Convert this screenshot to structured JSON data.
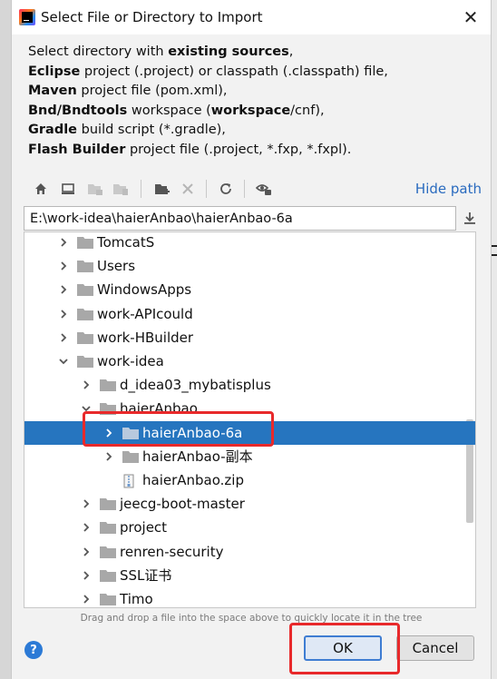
{
  "window": {
    "title": "Select File or Directory to Import",
    "close_symbol": "✕"
  },
  "description": {
    "line1": {
      "pre": "Select directory with ",
      "bold": "existing sources",
      "post": ","
    },
    "line2": {
      "bold": "Eclipse",
      "post": " project (.project) or classpath (.classpath) file,"
    },
    "line3": {
      "bold": "Maven",
      "post": " project file (pom.xml),"
    },
    "line4": {
      "bold": "Bnd/Bndtools",
      "mid": " workspace (",
      "bold2": "workspace",
      "post": "/cnf),"
    },
    "line5": {
      "bold": "Gradle",
      "post": " build script (*.gradle),"
    },
    "line6": {
      "bold": "Flash Builder",
      "post": " project file (.project, *.fxp, *.fxpl)."
    }
  },
  "toolbar": {
    "icons": [
      "home-icon",
      "desktop-icon",
      "project-folder-icon",
      "module-folder-icon",
      "new-folder-icon",
      "delete-icon",
      "refresh-icon",
      "show-hidden-icon"
    ],
    "hide_path_label": "Hide path"
  },
  "path": {
    "value": "E:\\work-idea\\haierAnbao\\haierAnbao-6a"
  },
  "tree": {
    "rows": [
      {
        "label": "TomcatS",
        "level": 0,
        "expanded": false,
        "type": "folder"
      },
      {
        "label": "Users",
        "level": 0,
        "expanded": false,
        "type": "folder"
      },
      {
        "label": "WindowsApps",
        "level": 0,
        "expanded": false,
        "type": "folder"
      },
      {
        "label": "work-APIcould",
        "level": 0,
        "expanded": false,
        "type": "folder"
      },
      {
        "label": "work-HBuilder",
        "level": 0,
        "expanded": false,
        "type": "folder"
      },
      {
        "label": "work-idea",
        "level": 0,
        "expanded": true,
        "type": "folder"
      },
      {
        "label": "d_idea03_mybatisplus",
        "level": 1,
        "expanded": false,
        "type": "folder"
      },
      {
        "label": "haierAnbao",
        "level": 1,
        "expanded": true,
        "type": "folder"
      },
      {
        "label": "haierAnbao-6a",
        "level": 2,
        "expanded": false,
        "type": "folder",
        "selected": true
      },
      {
        "label": "haierAnbao-副本",
        "level": 2,
        "expanded": false,
        "type": "folder"
      },
      {
        "label": "haierAnbao.zip",
        "level": 2,
        "type": "zip"
      },
      {
        "label": "jeecg-boot-master",
        "level": 1,
        "expanded": false,
        "type": "folder"
      },
      {
        "label": "project",
        "level": 1,
        "expanded": false,
        "type": "folder"
      },
      {
        "label": "renren-security",
        "level": 1,
        "expanded": false,
        "type": "folder"
      },
      {
        "label": "SSL证书",
        "level": 1,
        "expanded": false,
        "type": "folder"
      },
      {
        "label": "Timo",
        "level": 1,
        "expanded": false,
        "type": "folder"
      }
    ]
  },
  "drag_hint": "Drag and drop a file into the space above to quickly locate it in the tree",
  "buttons": {
    "help": "?",
    "ok": "OK",
    "cancel": "Cancel"
  },
  "colors": {
    "accent": "#2675bf",
    "link": "#2a6bbf",
    "highlight": "#e8292b"
  }
}
